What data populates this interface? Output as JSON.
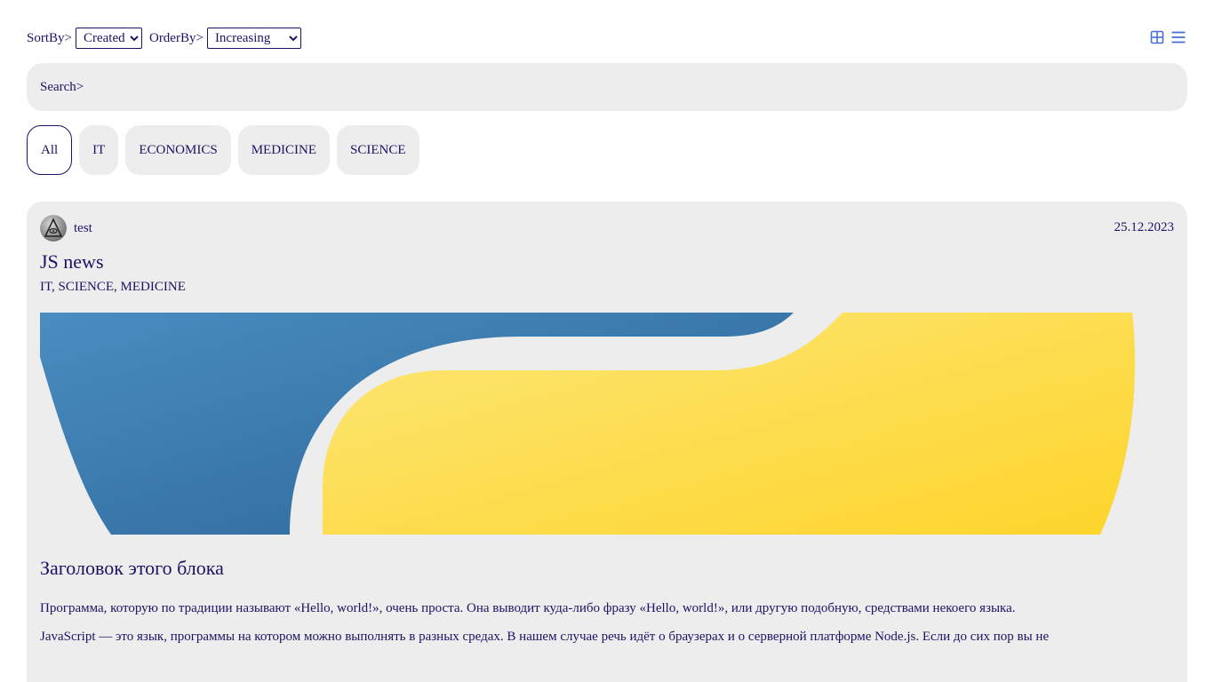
{
  "toolbar": {
    "sort_label": "SortBy>",
    "sort_selected": "Created",
    "order_label": "OrderBy>",
    "order_selected": "Increasing"
  },
  "view_icons": [
    "grid-view-icon",
    "list-view-icon"
  ],
  "search": {
    "label": "Search>",
    "value": ""
  },
  "filters": [
    "All",
    "IT",
    "ECONOMICS",
    "MEDICINE",
    "SCIENCE"
  ],
  "active_filter": "All",
  "post": {
    "author": "test",
    "date": "25.12.2023",
    "title": "JS news",
    "tags": "IT, SCIENCE, MEDICINE",
    "block_title": "Заголовок этого блока",
    "paragraph_1": "Программа, которую по традиции называют «Hello, world!», очень проста. Она выводит куда-либо фразу «Hello, world!», или другую подобную, средствами некоего языка.",
    "paragraph_2": "JavaScript — это язык, программы на котором можно выполнять в разных средах. В нашем случае речь идёт о браузерах и о серверной платформе Node.js. Если до сих пор вы не"
  },
  "colors": {
    "text": "#1a1464",
    "surface": "#ededed",
    "banner_blue": "#3a78ad",
    "banner_yellow": "#fdd935",
    "icon_blue": "#4a6fd6"
  }
}
